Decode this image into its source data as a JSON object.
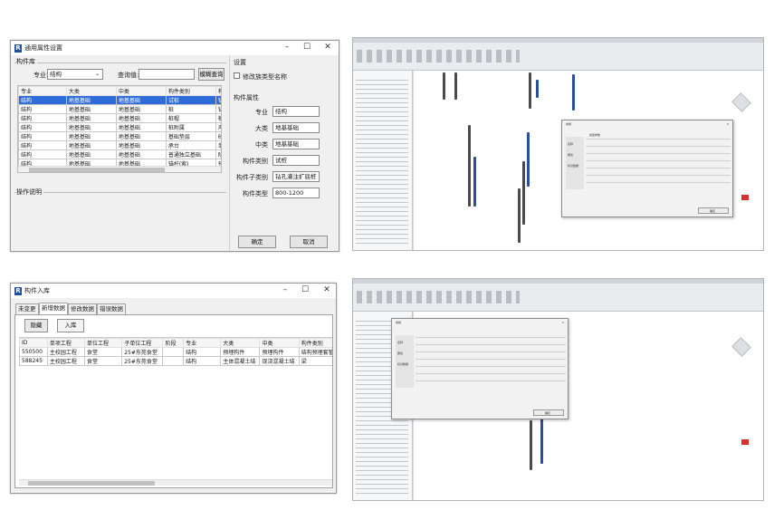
{
  "w1": {
    "title": "通用属性设置",
    "group_library": "构件库",
    "profession_label": "专业:",
    "profession_value": "结构",
    "query_label": "查询值:",
    "query_value": "",
    "fuzzy_button": "模糊查询",
    "columns": [
      "专业",
      "大类",
      "中类",
      "构件类别",
      "构"
    ],
    "rows": [
      [
        "结构",
        "地基基础",
        "地基基础",
        "试桩",
        "钻"
      ],
      [
        "结构",
        "地基基础",
        "地基基础",
        "桩",
        "钻"
      ],
      [
        "结构",
        "地基基础",
        "地基基础",
        "桩帽",
        "桩"
      ],
      [
        "结构",
        "地基基础",
        "地基基础",
        "桩附属",
        "声"
      ],
      [
        "结构",
        "地基基础",
        "地基基础",
        "基础垫层",
        "砂"
      ],
      [
        "结构",
        "地基基础",
        "地基基础",
        "承台",
        "单"
      ],
      [
        "结构",
        "地基基础",
        "地基基础",
        "普通独立基础",
        "阶"
      ],
      [
        "结构",
        "地基基础",
        "地基基础",
        "锚杆(索)",
        "预"
      ]
    ],
    "selected_row": 0,
    "operation_label": "操作说明",
    "settings_group": "设置",
    "modify_type_name": "修改族类型名称",
    "props_group": "构件属性",
    "prop_labels": [
      "专业",
      "大类",
      "中类",
      "构件类别",
      "构件子类别",
      "构件类型"
    ],
    "prop_values": [
      "结构",
      "地基基础",
      "地基基础",
      "试桩",
      "钻孔灌注扩底桩",
      "800-1200"
    ],
    "ok_button": "确定",
    "cancel_button": "取消"
  },
  "w2": {
    "title": "构件入库",
    "tabs": [
      "未变更",
      "新增数据",
      "修改数据",
      "错误数据"
    ],
    "active_tab": 1,
    "hide_button": "隐藏",
    "import_button": "入库",
    "columns": [
      "ID",
      "单项工程",
      "单位工程",
      "子单位工程",
      "阶段",
      "专业",
      "大类",
      "中类",
      "构件类别"
    ],
    "rows": [
      [
        "550500",
        "主校园工程",
        "食堂",
        "25#东苑食堂",
        "",
        "结构",
        "预埋构件",
        "预埋构件",
        "结构预埋套管"
      ],
      [
        "588245",
        "主校园工程",
        "食堂",
        "25#东苑食堂",
        "",
        "结构",
        "主体混凝土结",
        "现浇混凝土结",
        "梁"
      ]
    ]
  },
  "revit_a": {
    "dialog_title": "常规",
    "panel_items": [
      "名称",
      "属性",
      "标识数据"
    ],
    "grid_labels": [
      "类型参数",
      "参数",
      "值"
    ],
    "ok_label": "确定"
  },
  "revit_b": {
    "dialog_title": "常规",
    "panel_items": [
      "名称",
      "属性",
      "标识数据"
    ],
    "ok_label": "确定"
  },
  "colors": {
    "accent": "#2f6bd9",
    "column_dark": "#4a4a4a",
    "column_blue": "#2a4f9a"
  }
}
